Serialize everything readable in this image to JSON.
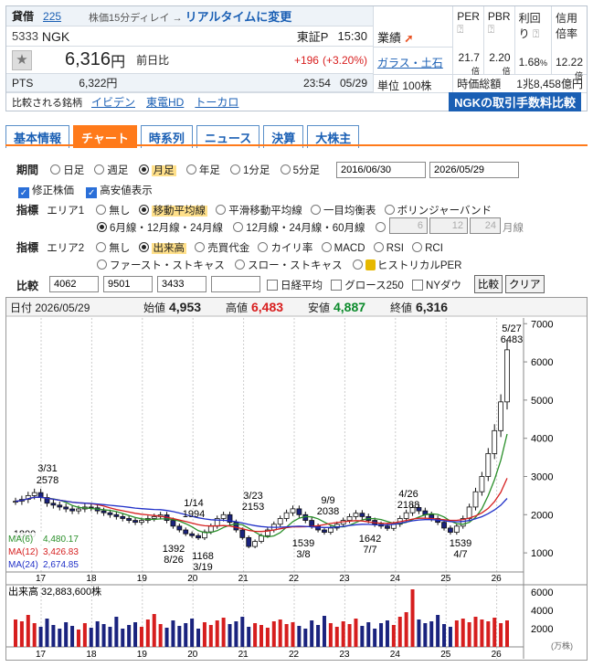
{
  "quote": {
    "tag": "貸借",
    "market_code": "225",
    "delay_note": "株価15分ディレイ → リアルタイムに変更",
    "code": "5333",
    "name": "NGK",
    "exchange": "東証P",
    "time": "15:30",
    "price": "6,316",
    "price_unit": "円",
    "prev_label": "前日比",
    "change": "+196",
    "change_pct": "(+3.20%)",
    "pts_label": "PTS",
    "pts_price": "6,322円",
    "pts_time": "23:54",
    "pts_date": "05/29",
    "compare_label": "比較される銘柄",
    "compare_links": [
      "イビデン",
      "東電HD",
      "トーカロ"
    ],
    "performance_label": "業績",
    "industry": "ガラス・土石",
    "unit_label": "単位",
    "unit_value": "100株",
    "metrics": [
      {
        "label": "PER",
        "value": "21.7",
        "unit": "倍"
      },
      {
        "label": "PBR",
        "value": "2.20",
        "unit": "倍"
      },
      {
        "label": "利回り",
        "value": "1.68",
        "unit": "%"
      },
      {
        "label": "信用倍率",
        "value": "12.22",
        "unit": "倍"
      }
    ],
    "mcap_label": "時価総額",
    "mcap_value": "1兆8,458億円",
    "fee_banner": "NGKの取引手数料比較"
  },
  "tabs": [
    "基本情報",
    "チャート",
    "時系列",
    "ニュース",
    "決算",
    "大株主"
  ],
  "controls": {
    "period_label": "期間",
    "periods": [
      "日足",
      "週足",
      "月足",
      "年足",
      "1分足",
      "5分足"
    ],
    "date_from": "2016/06/30",
    "date_to": "2026/05/29",
    "adj_label": "修正株価",
    "hilo_label": "高安値表示",
    "indicator_label": "指標",
    "area1_label": "エリア1",
    "area1_opts": [
      "無し",
      "移動平均線",
      "平滑移動平均線",
      "一目均衡表",
      "ボリンジャーバンド"
    ],
    "ma_opt1": "6月線・12月線・24月線",
    "ma_opt2": "12月線・24月線・60月線",
    "ma_inputs": [
      "6",
      "12",
      "24"
    ],
    "ma_unit": "月線",
    "area2_label": "エリア2",
    "area2_opts": [
      "無し",
      "出来高",
      "売買代金",
      "カイリ率",
      "MACD",
      "RSI",
      "RCI"
    ],
    "area2_opts_b": [
      "ファースト・ストキャス",
      "スロー・ストキャス",
      "ヒストリカルPER"
    ],
    "compare_label": "比較",
    "compare_inputs": [
      "4062",
      "9501",
      "3433",
      ""
    ],
    "nikkei_label": "日経平均",
    "growth_label": "グロース250",
    "ny_label": "NYダウ",
    "compare_btn": "比較",
    "clear_btn": "クリア"
  },
  "chart_data": {
    "type": "candlestick",
    "header": {
      "date_label": "日付",
      "date": "2026/05/29",
      "open_label": "始値",
      "open": "4,953",
      "high_label": "高値",
      "high": "6,483",
      "low_label": "安値",
      "low": "4,887",
      "close_label": "終値",
      "close": "6,316"
    },
    "xlabels": [
      "17",
      "18",
      "19",
      "20",
      "21",
      "22",
      "23",
      "24",
      "25",
      "26"
    ],
    "yticks": [
      1000,
      2000,
      3000,
      4000,
      5000,
      6000,
      7000
    ],
    "ylim": [
      1000,
      7000
    ],
    "close_series": [
      2350,
      2400,
      2500,
      2578,
      2450,
      2300,
      2250,
      2200,
      2150,
      2100,
      2150,
      2200,
      2180,
      2100,
      2050,
      2000,
      1950,
      1900,
      1850,
      1800,
      1850,
      1900,
      1950,
      1994,
      1850,
      1700,
      1600,
      1500,
      1450,
      1392,
      1550,
      1700,
      1900,
      2000,
      1800,
      1600,
      1400,
      1168,
      1300,
      1450,
      1600,
      1750,
      1900,
      2050,
      2153,
      2000,
      1850,
      1700,
      1600,
      1539,
      1650,
      1750,
      1850,
      1950,
      2038,
      1950,
      1850,
      1750,
      1700,
      1642,
      1750,
      1900,
      2050,
      2188,
      2100,
      2000,
      1900,
      1800,
      1650,
      1539,
      1700,
      1900,
      2200,
      2600,
      3000,
      3600,
      4200,
      4953,
      6316
    ],
    "annotations": [
      {
        "t": "3/31",
        "v": "2578"
      },
      {
        "t": "1800"
      },
      {
        "t": "1/14",
        "v": "1994"
      },
      {
        "t": "1392",
        "v": "8/26"
      },
      {
        "t": "1168",
        "v": "3/19"
      },
      {
        "t": "3/23",
        "v": "2153"
      },
      {
        "t": "9/9",
        "v": "2038"
      },
      {
        "t": "1539",
        "v": "3/8"
      },
      {
        "t": "1642",
        "v": "7/7"
      },
      {
        "t": "4/26",
        "v": "2188"
      },
      {
        "t": "1539",
        "v": "4/7"
      },
      {
        "t": "5/27",
        "v": "6483"
      }
    ],
    "ma": [
      {
        "name": "MA(6)",
        "value": "4,480.17",
        "color": "#2a8f2a"
      },
      {
        "name": "MA(12)",
        "value": "3,426.83",
        "color": "#d62020"
      },
      {
        "name": "MA(24)",
        "value": "2,674.85",
        "color": "#2030c8"
      }
    ],
    "volume_label": "出来高",
    "volume_value": "32,883,600株",
    "vol_yticks": [
      2000,
      4000,
      6000
    ],
    "vol_unit": "(万株)",
    "volumes": [
      3000,
      2800,
      3500,
      2600,
      2200,
      3100,
      2400,
      2000,
      2700,
      2300,
      1900,
      2600,
      2100,
      2800,
      2500,
      2200,
      3300,
      2000,
      2400,
      2700,
      2200,
      3000,
      3600,
      2500,
      2100,
      2900,
      2300,
      2600,
      3100,
      2000,
      2700,
      2400,
      2900,
      3200,
      2500,
      2800,
      3300,
      2200,
      2600,
      2400,
      2100,
      2800,
      3000,
      2500,
      2700,
      2300,
      2000,
      2900,
      2400,
      3400,
      2600,
      2200,
      2800,
      2500,
      3100,
      2300,
      2700,
      2000,
      2600,
      2900,
      2400,
      3300,
      3800,
      6300,
      3000,
      2600,
      2800,
      3500,
      2500,
      2200,
      2900,
      3100,
      2700,
      3300,
      3000,
      2800,
      3200,
      2600,
      2900
    ]
  }
}
